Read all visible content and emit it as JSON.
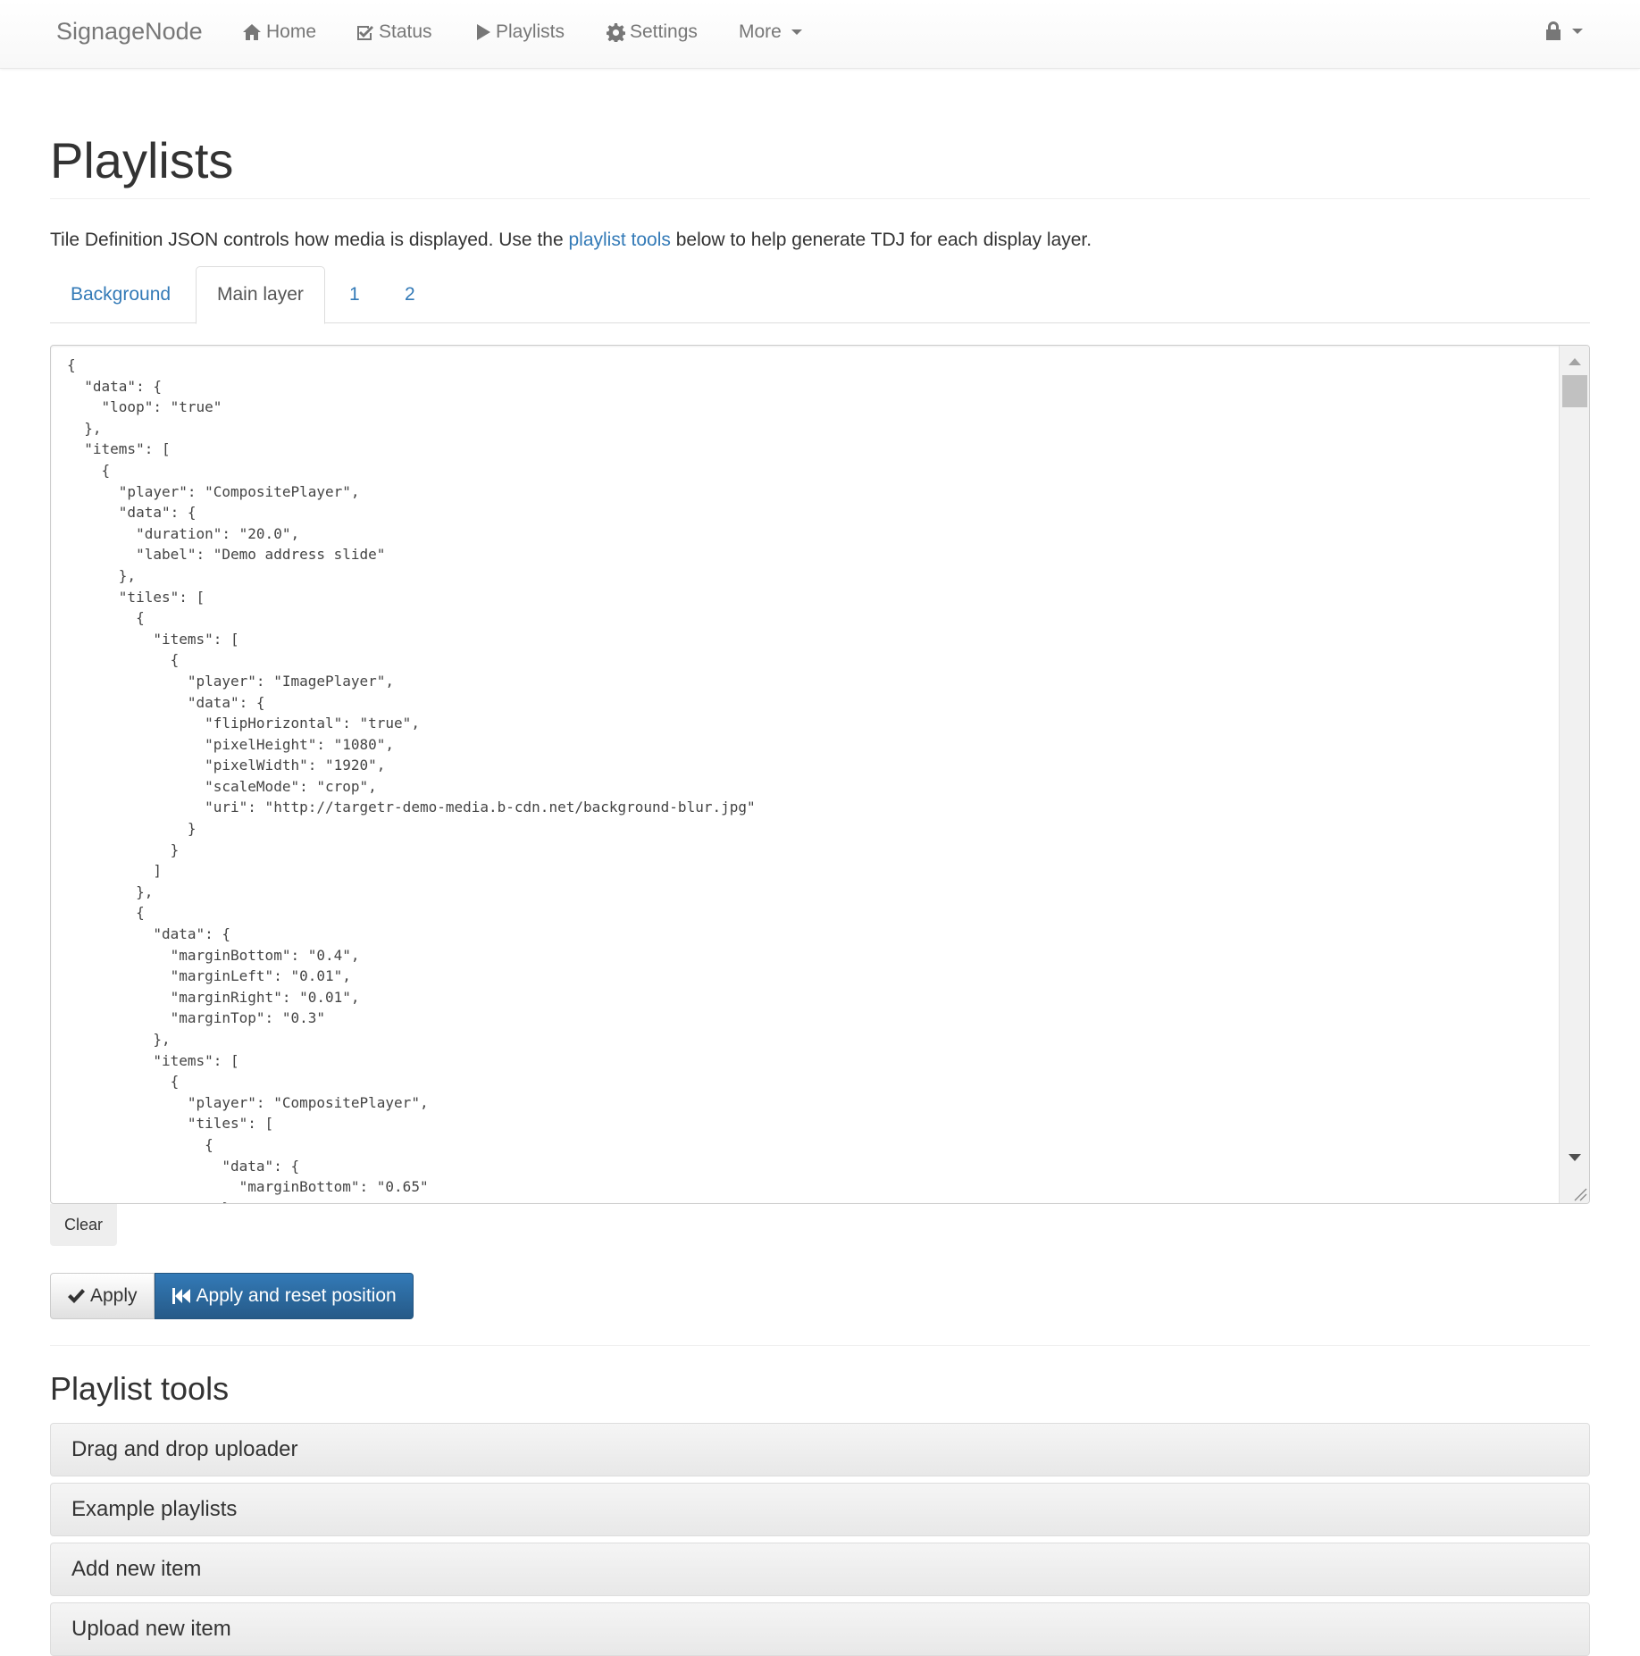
{
  "navbar": {
    "brand": "SignageNode",
    "items": [
      {
        "label": "Home",
        "icon": "home-icon"
      },
      {
        "label": "Status",
        "icon": "check-square-icon"
      },
      {
        "label": "Playlists",
        "icon": "play-icon"
      },
      {
        "label": "Settings",
        "icon": "gear-icon"
      },
      {
        "label": "More",
        "icon": "chevron-down-icon"
      }
    ],
    "user_menu_icon": "lock-icon"
  },
  "page": {
    "title": "Playlists",
    "intro_before": "Tile Definition JSON controls how media is displayed. Use the ",
    "intro_link": "playlist tools",
    "intro_after": " below to help generate TDJ for each display layer."
  },
  "tabs": [
    {
      "label": "Background",
      "active": false
    },
    {
      "label": "Main layer",
      "active": true
    },
    {
      "label": "1",
      "active": false
    },
    {
      "label": "2",
      "active": false
    }
  ],
  "editor": {
    "content": "{\n  \"data\": {\n    \"loop\": \"true\"\n  },\n  \"items\": [\n    {\n      \"player\": \"CompositePlayer\",\n      \"data\": {\n        \"duration\": \"20.0\",\n        \"label\": \"Demo address slide\"\n      },\n      \"tiles\": [\n        {\n          \"items\": [\n            {\n              \"player\": \"ImagePlayer\",\n              \"data\": {\n                \"flipHorizontal\": \"true\",\n                \"pixelHeight\": \"1080\",\n                \"pixelWidth\": \"1920\",\n                \"scaleMode\": \"crop\",\n                \"uri\": \"http://targetr-demo-media.b-cdn.net/background-blur.jpg\"\n              }\n            }\n          ]\n        },\n        {\n          \"data\": {\n            \"marginBottom\": \"0.4\",\n            \"marginLeft\": \"0.01\",\n            \"marginRight\": \"0.01\",\n            \"marginTop\": \"0.3\"\n          },\n          \"items\": [\n            {\n              \"player\": \"CompositePlayer\",\n              \"tiles\": [\n                {\n                  \"data\": {\n                    \"marginBottom\": \"0.65\"\n                  },"
  },
  "buttons": {
    "clear": "Clear",
    "apply": "Apply",
    "apply_reset": "Apply and reset position"
  },
  "tools": {
    "title": "Playlist tools",
    "panels": [
      "Drag and drop uploader",
      "Example playlists",
      "Add new item",
      "Upload new item"
    ]
  },
  "colors": {
    "link": "#337ab7",
    "primary": "#337ab7"
  }
}
